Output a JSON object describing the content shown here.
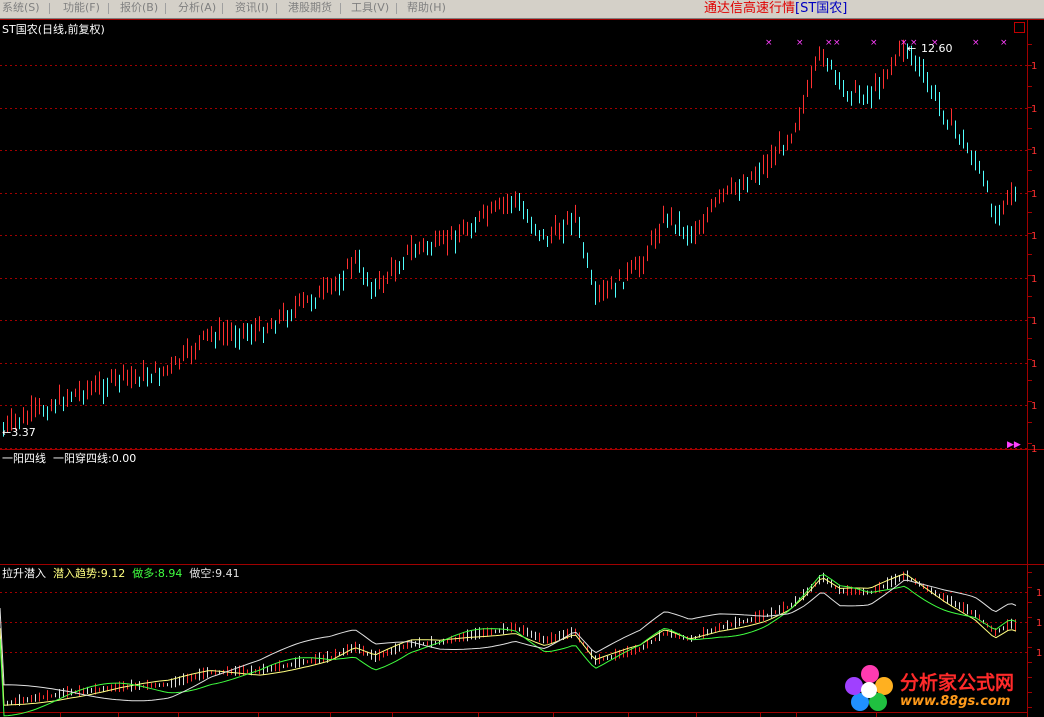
{
  "menu": {
    "items": [
      "系统(S)",
      "功能(F)",
      "报价(B)",
      "分析(A)",
      "资讯(I)",
      "港股期货",
      "工具(V)",
      "帮助(H)"
    ]
  },
  "app": {
    "title": "通达信高速行情",
    "stock_tag": "[ST国农]"
  },
  "main_panel": {
    "label": "ST国农(日线,前复权)",
    "high_label": "12.60",
    "low_label": "3.37"
  },
  "indicator1": {
    "name": "一阳四线",
    "values_text": "一阳穿四线:0.00"
  },
  "indicator2": {
    "name": "拉升潜入",
    "series": [
      {
        "label": "潜入趋势:9.12",
        "color": "#ffff80"
      },
      {
        "label": "做多:8.94",
        "color": "#40ff40"
      },
      {
        "label": "做空:9.41",
        "color": "#e0e0e0"
      }
    ]
  },
  "logo": {
    "text": "分析家公式网",
    "url": "www.88gs.com"
  },
  "colors": {
    "up": "#ff3030",
    "down": "#50ffff",
    "grid": "#a00000",
    "marker": "#ff40ff"
  },
  "chart_data": {
    "type": "candlestick",
    "price_min": 3.37,
    "price_max": 12.6
  }
}
